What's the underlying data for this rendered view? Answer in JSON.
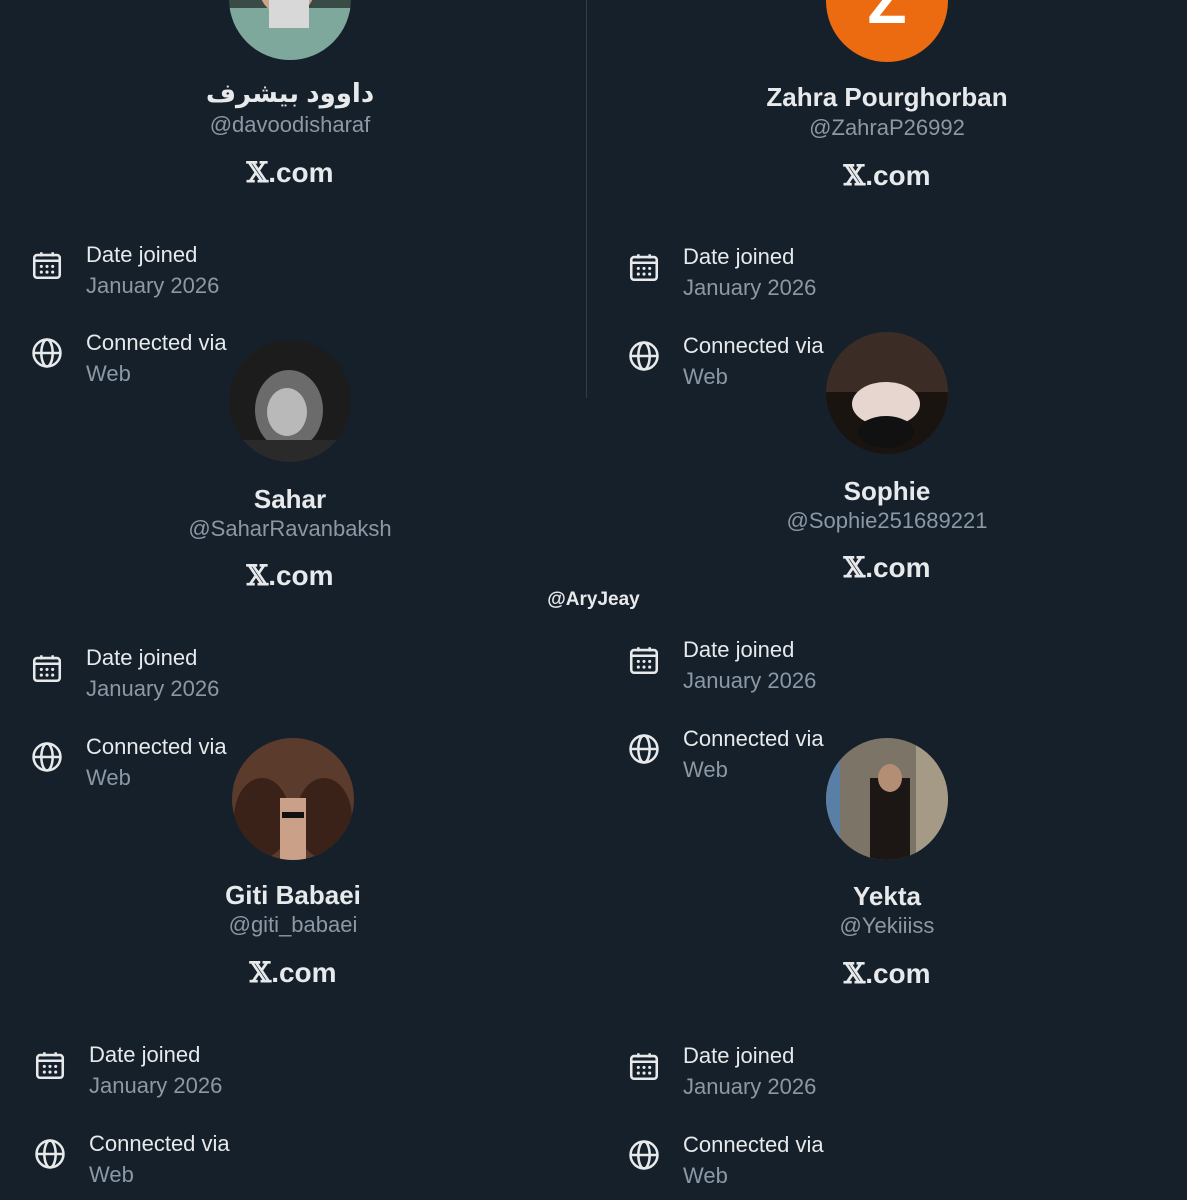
{
  "watermark": "@AryJeay",
  "labels": {
    "date_joined": "Date joined",
    "connected_via": "Connected via",
    "x_mark": "𝕏",
    "x_suffix": ".com"
  },
  "profiles": [
    {
      "name": "داوود بیشرف",
      "handle": "@davoodisharaf",
      "joined": "January 2026",
      "via": "Web",
      "avatar": "photo"
    },
    {
      "name": "Zahra Pourghorban",
      "handle": "@ZahraP26992",
      "joined": "January 2026",
      "via": "Web",
      "avatar": "Z",
      "avatar_color": "#ec6a10"
    },
    {
      "name": "Sahar",
      "handle": "@SaharRavanbaksh",
      "joined": "January 2026",
      "via": "Web",
      "avatar": "photo"
    },
    {
      "name": "Sophie",
      "handle": "@Sophie251689221",
      "joined": "January 2026",
      "via": "Web",
      "avatar": "photo"
    },
    {
      "name": "Giti Babaei",
      "handle": "@giti_babaei",
      "joined": "January 2026",
      "via": "Web",
      "avatar": "photo"
    },
    {
      "name": "Yekta",
      "handle": "@Yekiiiss",
      "joined": "January 2026",
      "via": "Web",
      "avatar": "photo"
    }
  ]
}
